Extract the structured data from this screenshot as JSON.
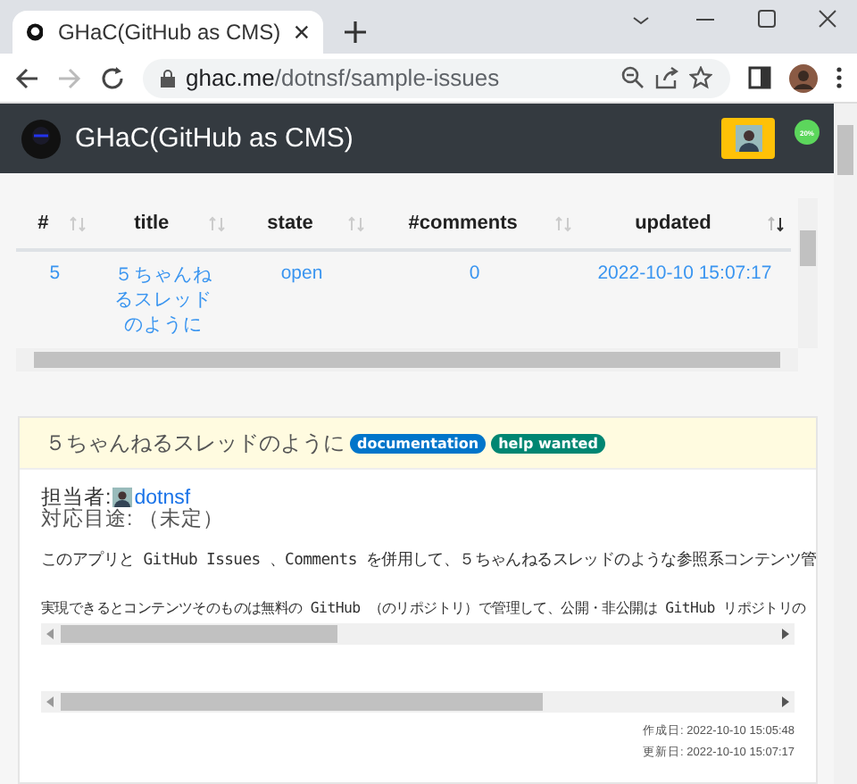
{
  "browser": {
    "tab_title": "GHaC(GitHub as CMS)",
    "url_host": "ghac.me",
    "url_path": "/dotnsf/sample-issues"
  },
  "navbar": {
    "brand": "GHaC(GitHub as CMS)",
    "badge": "20%"
  },
  "table": {
    "columns": [
      {
        "label": "#",
        "sorted": false
      },
      {
        "label": "title",
        "sorted": false
      },
      {
        "label": "state",
        "sorted": false
      },
      {
        "label": "#comments",
        "sorted": false
      },
      {
        "label": "updated",
        "sorted": true
      }
    ],
    "rows": [
      {
        "number": "5",
        "title": "５ちゃんねるスレッドのように",
        "state": "open",
        "comments": "0",
        "updated": "2022-10-10 15:07:17"
      }
    ]
  },
  "issue": {
    "title": "５ちゃんねるスレッドのように",
    "labels": [
      {
        "name": "documentation",
        "color": "#0075ca"
      },
      {
        "name": "help wanted",
        "color": "#008672"
      }
    ],
    "assignee_label": "担当者:",
    "assignee": "dotnsf",
    "milestone": "対応目途: （未定）",
    "body": [
      "このアプリと GitHub Issues 、Comments を併用して、５ちゃんねるスレッドのような参照系コンテンツ管",
      "実現できるとコンテンツそのものは無料の GitHub （のリポジトリ）で管理して、公開・非公開は GitHub リポジトリの"
    ],
    "created": "作成日: 2022-10-10 15:05:48",
    "updated": "更新日: 2022-10-10 15:07:17"
  }
}
